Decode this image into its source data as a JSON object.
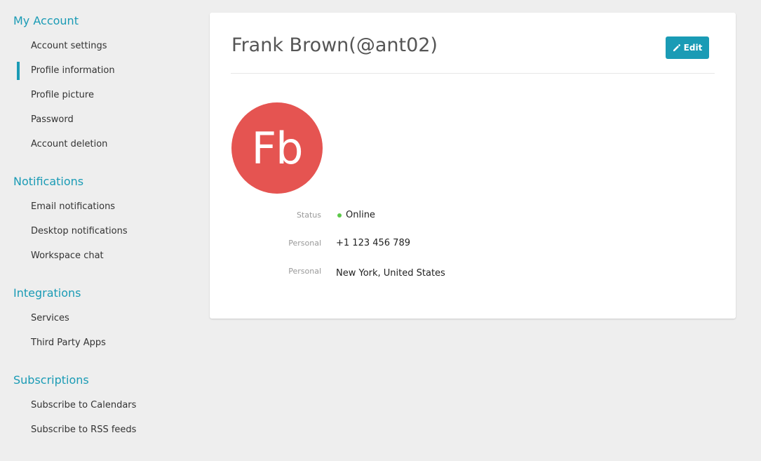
{
  "sidebar": {
    "sections": [
      {
        "title": "My Account",
        "items": [
          "Account settings",
          "Profile information",
          "Profile picture",
          "Password",
          "Account deletion"
        ]
      },
      {
        "title": "Notifications",
        "items": [
          "Email notifications",
          "Desktop notifications",
          "Workspace chat"
        ]
      },
      {
        "title": "Integrations",
        "items": [
          "Services",
          "Third Party Apps"
        ]
      },
      {
        "title": "Subscriptions",
        "items": [
          "Subscribe to Calendars",
          "Subscribe to RSS feeds"
        ]
      }
    ],
    "active_item": "Profile information"
  },
  "profile": {
    "title": "Frank Brown(@ant02)",
    "edit_label": "Edit",
    "avatar_initials": "Fb",
    "avatar_color": "#e55451",
    "fields": [
      {
        "label": "Status",
        "value": "Online",
        "status_color": "#5cc84a"
      },
      {
        "label": "Personal",
        "value": "+1 123 456 789"
      },
      {
        "label": "Personal",
        "value": "New York, United States"
      }
    ]
  },
  "colors": {
    "accent": "#1a9bb5",
    "background": "#eeeeee"
  },
  "icons": {
    "edit": "pencil-icon",
    "status": "status-dot-icon"
  }
}
